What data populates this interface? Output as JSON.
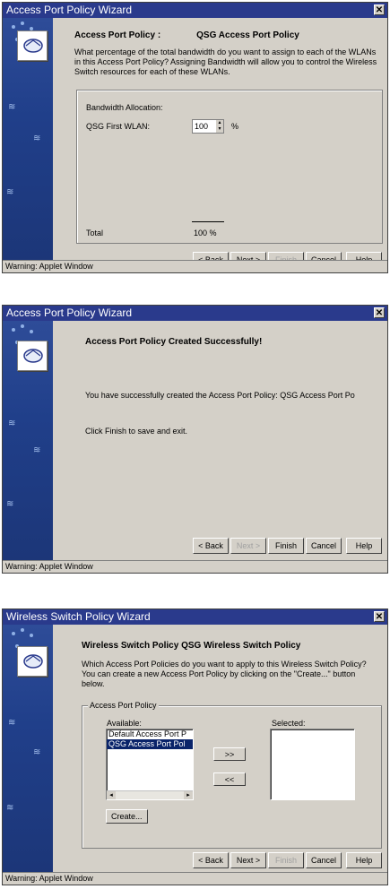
{
  "wizard1": {
    "title": "Access Port Policy Wizard",
    "policy_label": "Access Port Policy :",
    "policy_name": "QSG Access Port Policy",
    "description": "What percentage of the total bandwidth do you want to assign to each of the WLANs in this Access Port Policy? Assigning Bandwidth will allow you to control the Wireless Switch resources for each of these WLANs.",
    "bandwidth_heading": "Bandwidth Allocation:",
    "wlan_label": "QSG First WLAN:",
    "wlan_value": "100",
    "percent_sign": "%",
    "total_label": "Total",
    "total_value": "100 %",
    "buttons": {
      "back": "< Back",
      "next": "Next >",
      "finish": "Finish",
      "cancel": "Cancel",
      "help": "Help"
    },
    "status": "Warning: Applet Window"
  },
  "wizard2": {
    "title": "Access Port Policy Wizard",
    "heading": "Access Port Policy Created Successfully!",
    "message": "You have successfully created the Access Port Policy: QSG Access Port Po",
    "instruction": "Click Finish to save and exit.",
    "buttons": {
      "back": "< Back",
      "next": "Next >",
      "finish": "Finish",
      "cancel": "Cancel",
      "help": "Help"
    },
    "status": "Warning: Applet Window"
  },
  "wizard3": {
    "title": "Wireless Switch Policy Wizard",
    "heading": "Wireless Switch Policy QSG Wireless Switch Policy",
    "description": "Which Access Port Policies do you want to apply to this Wireless Switch Policy?  You can create a new Access Port Policy by clicking on the \"Create...\" button below.",
    "group_label": "Access Port Policy",
    "available_label": "Available:",
    "selected_label": "Selected:",
    "available_items": [
      "Default Access Port P",
      "QSG Access Port Pol"
    ],
    "add_button": ">>",
    "remove_button": "<<",
    "create_button": "Create...",
    "buttons": {
      "back": "< Back",
      "next": "Next >",
      "finish": "Finish",
      "cancel": "Cancel",
      "help": "Help"
    },
    "status": "Warning: Applet Window"
  }
}
